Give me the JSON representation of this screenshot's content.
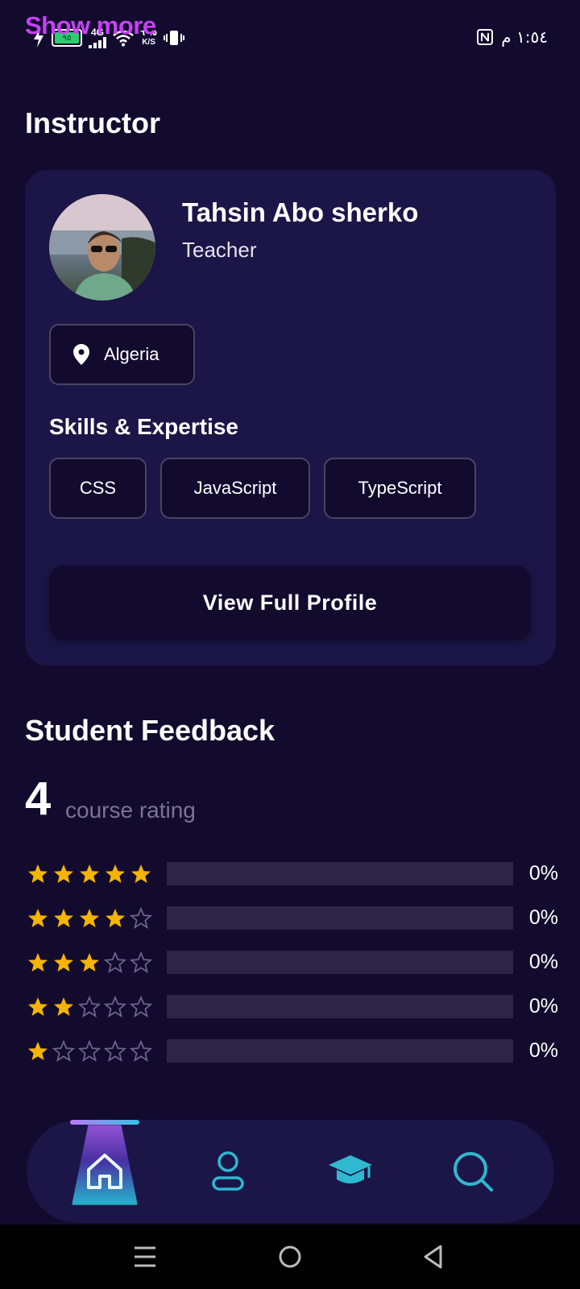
{
  "status_bar": {
    "time": "١:٥٤ م",
    "battery": "٩٥",
    "network": "4G",
    "speed_value": "٦٠.٥",
    "speed_unit": "K/S"
  },
  "overlay": {
    "show_more": "Show more"
  },
  "instructor": {
    "section_title": "Instructor",
    "name": "Tahsin Abo sherko",
    "role": "Teacher",
    "location": "Algeria",
    "skills_title": "Skills & Expertise",
    "skills": [
      "CSS",
      "JavaScript",
      "TypeScript"
    ],
    "view_profile_label": "View Full Profile"
  },
  "feedback": {
    "section_title": "Student Feedback",
    "rating": "4",
    "rating_label": "course rating",
    "rows": [
      {
        "stars": 5,
        "percent_label": "0%",
        "fraction": 0
      },
      {
        "stars": 4,
        "percent_label": "0%",
        "fraction": 0
      },
      {
        "stars": 3,
        "percent_label": "0%",
        "fraction": 0
      },
      {
        "stars": 2,
        "percent_label": "0%",
        "fraction": 0
      },
      {
        "stars": 1,
        "percent_label": "0%",
        "fraction": 0
      }
    ]
  },
  "bottom_nav": {
    "items": [
      "home-icon",
      "profile-icon",
      "courses-icon",
      "search-icon"
    ],
    "active": "home-icon"
  },
  "colors": {
    "background": "#130b2e",
    "card": "#1c1547",
    "star_filled": "#f5b400",
    "accent_cyan": "#35c3e0",
    "accent_magenta": "#c840f5"
  }
}
